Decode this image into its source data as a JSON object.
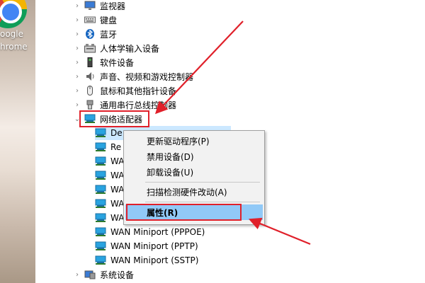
{
  "desktop": {
    "shortcut_label_line1": "oogle",
    "shortcut_label_line2": "hrome"
  },
  "tree": {
    "categories_top": [
      {
        "label": "监视器",
        "icon": "monitor-icon"
      },
      {
        "label": "键盘",
        "icon": "keyboard-icon"
      },
      {
        "label": "蓝牙",
        "icon": "bluetooth-icon"
      },
      {
        "label": "人体学输入设备",
        "icon": "hid-icon"
      },
      {
        "label": "软件设备",
        "icon": "software-device-icon"
      },
      {
        "label": "声音、视频和游戏控制器",
        "icon": "speaker-icon"
      },
      {
        "label": "鼠标和其他指针设备",
        "icon": "mouse-icon"
      },
      {
        "label": "通用串行总线控制器",
        "icon": "usb-icon"
      }
    ],
    "network_adapters": {
      "label": "网络适配器",
      "icon": "network-adapter-icon",
      "children": [
        "De",
        "Re",
        "WA",
        "WA",
        "WA",
        "WA",
        "WA",
        "WAN Miniport (PPPOE)",
        "WAN Miniport (PPTP)",
        "WAN Miniport (SSTP)"
      ]
    },
    "system_devices": {
      "label": "系统设备",
      "icon": "system-device-icon"
    }
  },
  "context_menu": {
    "items": [
      "更新驱动程序(P)",
      "禁用设备(D)",
      "卸载设备(U)",
      "扫描检测硬件改动(A)",
      "属性(R)"
    ],
    "highlighted_index": 4
  },
  "colors": {
    "annotation_red": "#e0202a",
    "selection_blue": "#cce8ff",
    "menu_highlight": "#91c9f7"
  }
}
